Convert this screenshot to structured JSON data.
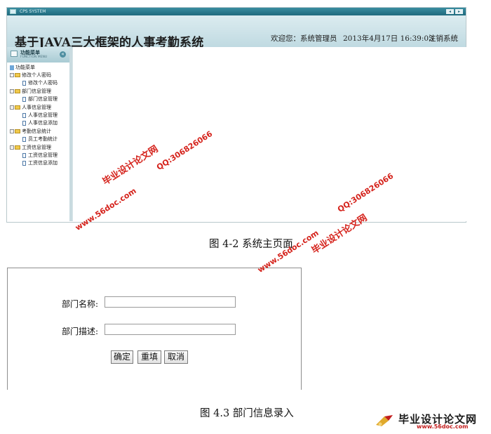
{
  "figure1": {
    "window": {
      "title": "CPS SYSTEM"
    },
    "header": {
      "app_title": "基于JAVA三大框架的人事考勤系统",
      "welcome": "欢迎您：系统管理员",
      "datetime": "2013年4月17日  16:39:03",
      "logout": "注销系统"
    },
    "sidebar": {
      "title": "功能菜单",
      "subtitle": "FUNCTION MENU",
      "root": "功能菜单",
      "groups": [
        {
          "label": "修改个人密码",
          "items": [
            "修改个人密码"
          ]
        },
        {
          "label": "部门信息管理",
          "items": [
            "部门信息管理"
          ]
        },
        {
          "label": "人事信息管理",
          "items": [
            "人事信息管理",
            "人事信息添加"
          ]
        },
        {
          "label": "考勤信息统计",
          "items": [
            "员工考勤统计"
          ]
        },
        {
          "label": "工资信息管理",
          "items": [
            "工资信息管理",
            "工资信息添加"
          ]
        }
      ]
    },
    "caption": "图 4-2 系统主页面"
  },
  "figure2": {
    "fields": [
      {
        "label": "部门名称:",
        "value": ""
      },
      {
        "label": "部门描述:",
        "value": ""
      }
    ],
    "buttons": {
      "confirm": "确定",
      "reset": "重填",
      "cancel": "取消"
    },
    "caption": "图 4.3  部门信息录入"
  },
  "watermarks": {
    "site_cn": "毕业设计论文网",
    "site_url": "www.56doc.com",
    "qq": "QQ:306826066"
  },
  "brand": {
    "name": "毕业设计论文网",
    "url": "www.56doc.com",
    "accent": "#c21d1d"
  }
}
